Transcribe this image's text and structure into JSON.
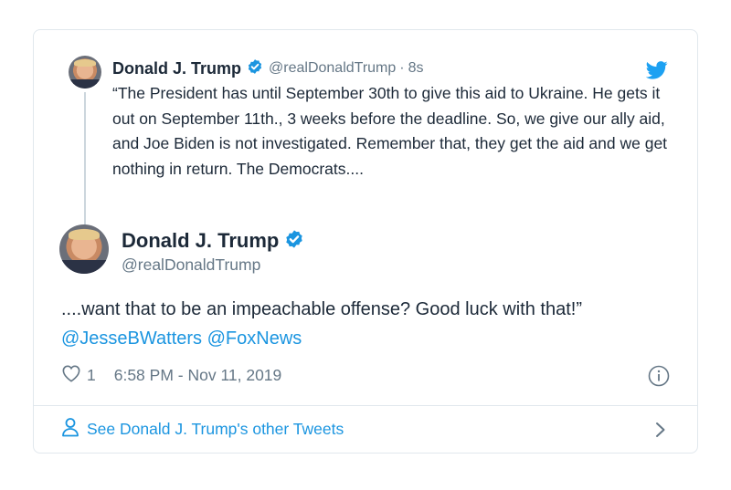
{
  "quoted_tweet": {
    "name": "Donald J. Trump",
    "handle": "@realDonaldTrump",
    "separator": "·",
    "time_ago": "8s",
    "text": "“The President has until September 30th to give this aid to Ukraine. He gets it out on September 11th., 3 weeks before the deadline. So, we give our ally aid, and Joe Biden is not investigated. Remember that, they get the aid and we get nothing in return. The Democrats...."
  },
  "main_tweet": {
    "name": "Donald J. Trump",
    "handle": "@realDonaldTrump",
    "text": "....want that to be an impeachable offense? Good luck with that!”",
    "mentions": [
      "@JesseBWatters",
      "@FoxNews"
    ],
    "like_count": "1",
    "timestamp": "6:58 PM - Nov 11, 2019"
  },
  "footer": {
    "link_label": "See Donald J. Trump's other Tweets"
  },
  "colors": {
    "accent": "#1b95e0",
    "text": "#1c2938",
    "muted": "#657786",
    "border": "#e1e8ed"
  },
  "icons": [
    "verified-badge-icon",
    "twitter-bird-icon",
    "heart-icon",
    "info-icon",
    "user-icon",
    "chevron-right-icon"
  ]
}
